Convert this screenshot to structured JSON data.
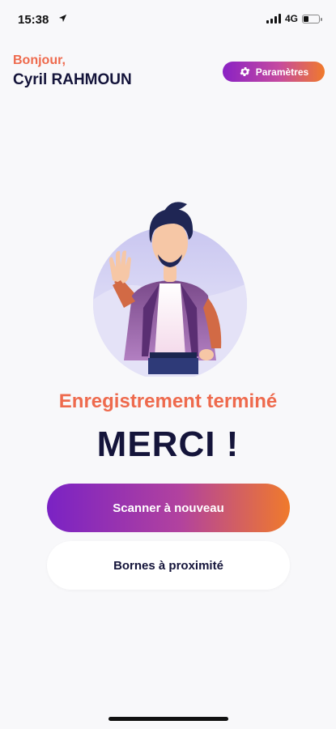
{
  "status_bar": {
    "time": "15:38",
    "network": "4G",
    "battery_fraction": 0.3,
    "signal_bars": 4
  },
  "header": {
    "greeting": "Bonjour,",
    "user_name": "Cyril RAHMOUN",
    "settings_label": "Paramètres"
  },
  "main": {
    "status_text": "Enregistrement terminé",
    "thanks_text": "MERCI !",
    "scan_again_label": "Scanner à nouveau",
    "nearby_label": "Bornes à proximité"
  },
  "colors": {
    "accent_orange": "#ee6a4d",
    "navy": "#14143a",
    "gradient_start": "#7a22c4",
    "gradient_end": "#f07a2b"
  },
  "icons": [
    "location-arrow-icon",
    "signal-icon",
    "battery-icon",
    "gear-icon"
  ]
}
